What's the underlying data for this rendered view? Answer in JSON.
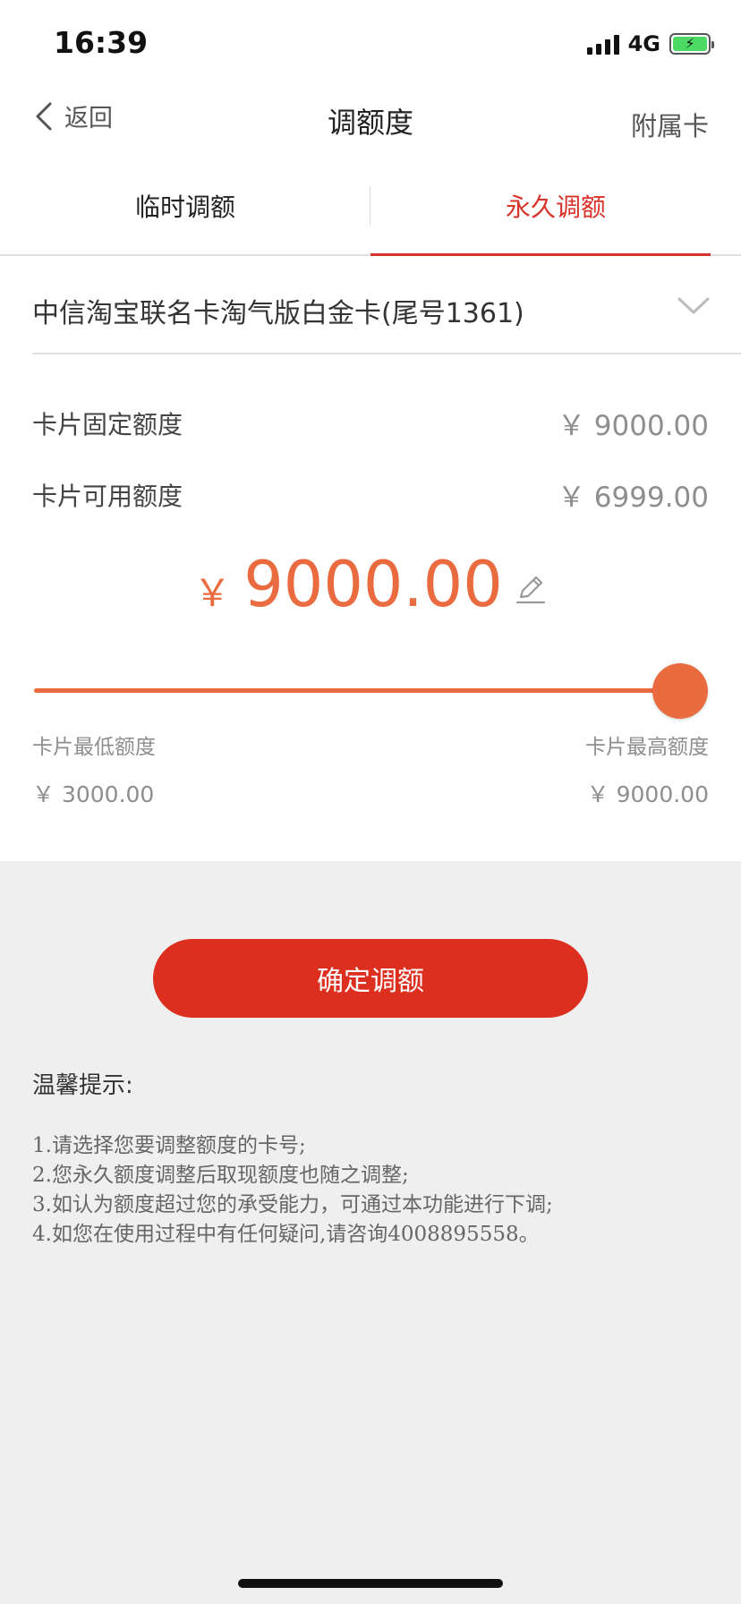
{
  "status_bar": {
    "time": "16:39",
    "network": "4G",
    "battery_level": 1.0
  },
  "nav": {
    "back_label": "返回",
    "title": "调额度",
    "right_label": "附属卡"
  },
  "tabs": [
    {
      "label": "临时调额",
      "active": false
    },
    {
      "label": "永久调额",
      "active": true
    }
  ],
  "card": {
    "name": "中信淘宝联名卡淘气版白金卡(尾号1361)"
  },
  "limits": {
    "fixed_label": "卡片固定额度",
    "fixed_value": "￥ 9000.00",
    "available_label": "卡片可用额度",
    "available_value": "￥ 6999.00"
  },
  "amount": {
    "currency": "￥",
    "value": "9000.00"
  },
  "slider": {
    "min": 3000,
    "max": 9000,
    "value": 9000,
    "min_label": "卡片最低额度",
    "max_label": "卡片最高额度",
    "min_value": "￥ 3000.00",
    "max_value": "￥ 9000.00"
  },
  "confirm_label": "确定调额",
  "tips": {
    "title": "温馨提示:",
    "items": [
      "1.请选择您要调整额度的卡号;",
      "2.您永久额度调整后取现额度也随之调整;",
      "3.如认为额度超过您的承受能力，可通过本功能进行下调;",
      "4.如您在使用过程中有任何疑问,请咨询4008895558。"
    ]
  },
  "colors": {
    "accent_red": "#dc2f20",
    "tab_active": "#d8322a",
    "amount_orange": "#ea6b40",
    "background_gray": "#efefef"
  }
}
